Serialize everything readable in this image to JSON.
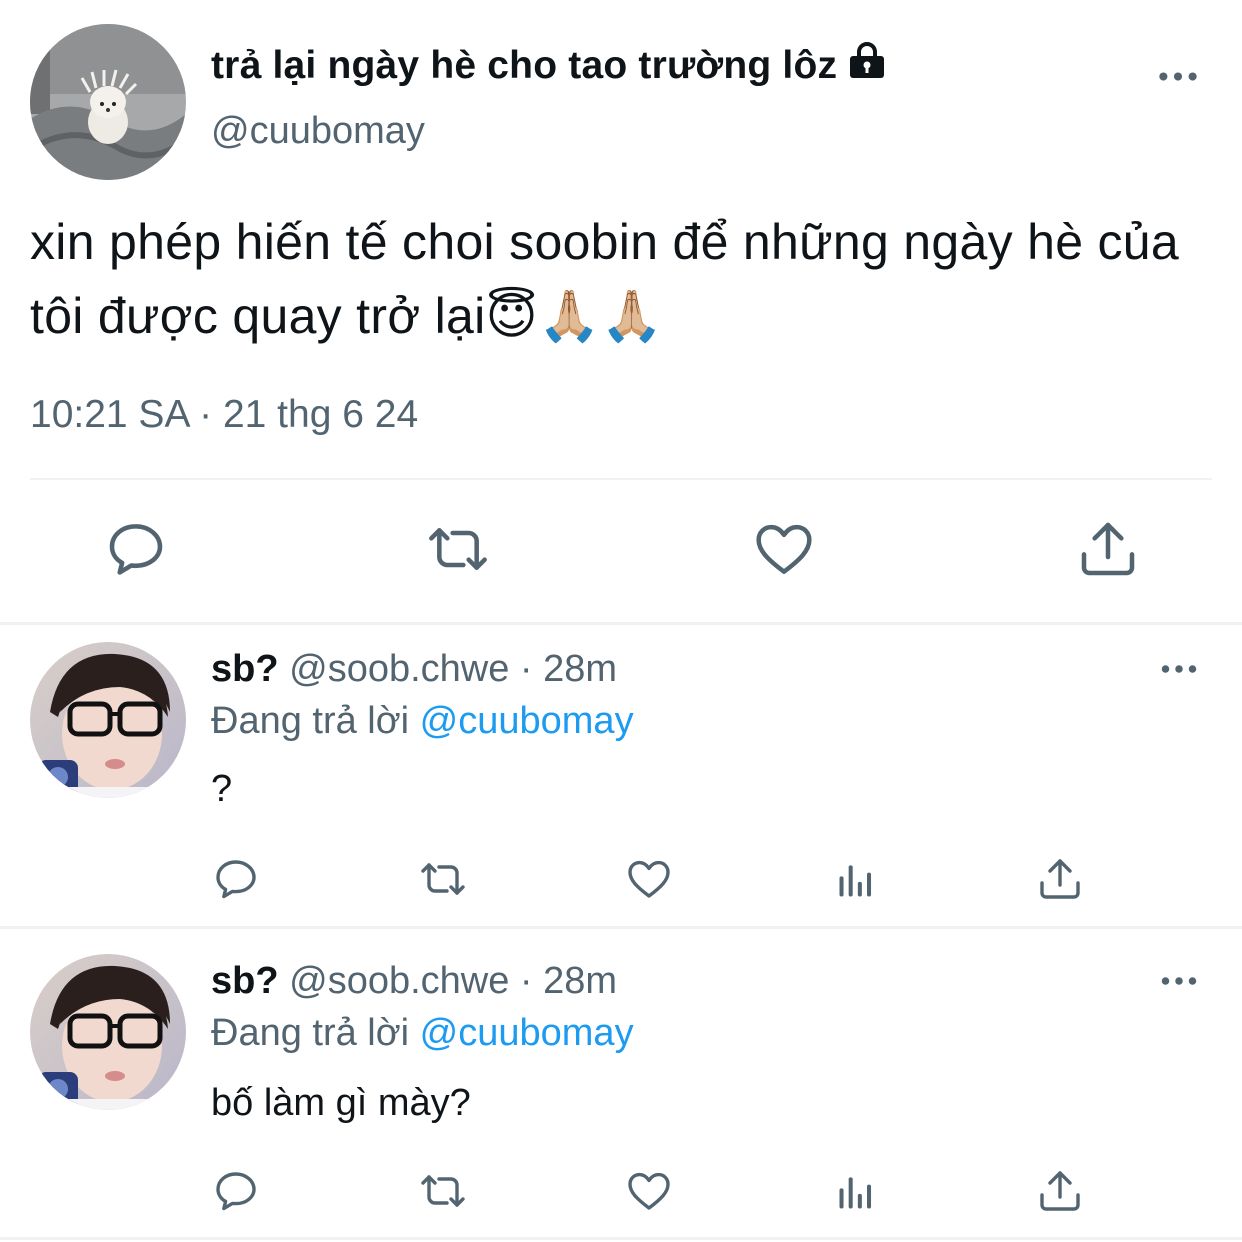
{
  "main_tweet": {
    "display_name": "trả lại ngày hè cho tao trường lôz",
    "handle": "@cuubomay",
    "text": "xin phép hiến tế choi soobin để những ngày hè của tôi được quay trở lại😇🙏🏼🙏🏼",
    "timestamp": "10:21 SA · 21 thg 6 24",
    "actions": [
      "reply-icon",
      "retweet-icon",
      "like-icon",
      "share-icon"
    ]
  },
  "replies": [
    {
      "display_name": "sb?",
      "handle": "@soob.chwe",
      "meta": " · 28m",
      "replying_label": "Đang trả lời ",
      "replying_to": "@cuubomay",
      "text": "?"
    },
    {
      "display_name": "sb?",
      "handle": "@soob.chwe",
      "meta": " · 28m",
      "replying_label": "Đang trả lời ",
      "replying_to": "@cuubomay",
      "text": "bố làm gì mày?"
    }
  ],
  "colors": {
    "text": "#0f1419",
    "secondary": "#536471",
    "accent": "#1d9bf0",
    "divider": "#eff3f4"
  }
}
